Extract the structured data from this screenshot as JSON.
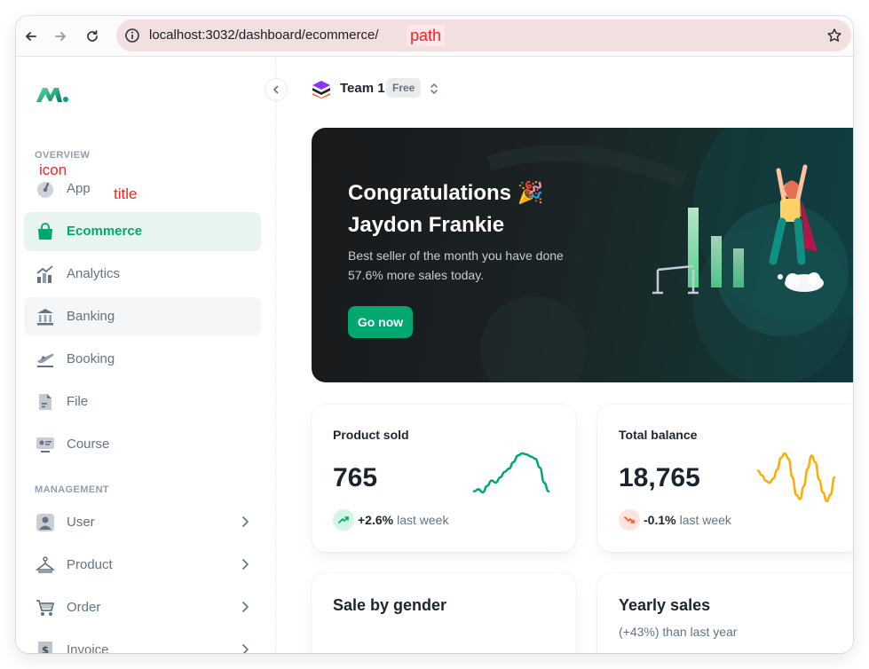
{
  "browser": {
    "url": "localhost:3032/dashboard/ecommerce/",
    "path_annotation": "path"
  },
  "annotations": {
    "icon": "icon",
    "title": "title"
  },
  "sidebar": {
    "overview_label": "OVERVIEW",
    "management_label": "MANAGEMENT",
    "overview_items": [
      {
        "label": "App",
        "icon": "speedometer-icon"
      },
      {
        "label": "Ecommerce",
        "icon": "shopping-bag-icon",
        "active": true
      },
      {
        "label": "Analytics",
        "icon": "analytics-chart-icon"
      },
      {
        "label": "Banking",
        "icon": "bank-icon"
      },
      {
        "label": "Booking",
        "icon": "airplane-icon"
      },
      {
        "label": "File",
        "icon": "file-icon"
      },
      {
        "label": "Course",
        "icon": "course-icon"
      }
    ],
    "management_items": [
      {
        "label": "User",
        "icon": "user-icon"
      },
      {
        "label": "Product",
        "icon": "hanger-icon"
      },
      {
        "label": "Order",
        "icon": "cart-icon"
      },
      {
        "label": "Invoice",
        "icon": "invoice-icon"
      }
    ]
  },
  "workspace": {
    "team": "Team 1",
    "plan": "Free"
  },
  "hero": {
    "title_line1": "Congratulations 🎉",
    "title_line2": "Jaydon Frankie",
    "description": "Best seller of the month you have done 57.6% more sales today.",
    "button": "Go now"
  },
  "stats": [
    {
      "title": "Product sold",
      "value": "765",
      "change": "+2.6%",
      "period": "last week",
      "trend": "up",
      "color": "#00a76f",
      "sparkline": [
        20,
        22,
        19,
        25,
        30,
        28,
        33,
        38,
        41,
        47,
        53,
        55,
        54,
        52,
        50,
        42,
        28,
        20
      ]
    },
    {
      "title": "Total balance",
      "value": "18,765",
      "change": "-0.1%",
      "period": "last week",
      "trend": "down",
      "color": "#ffab00",
      "sparkline": [
        44,
        40,
        35,
        33,
        37,
        45,
        56,
        60,
        55,
        38,
        22,
        18,
        30,
        46,
        58,
        52,
        36,
        24,
        16,
        22,
        38
      ]
    }
  ],
  "cards": {
    "sale_by_gender": "Sale by gender",
    "yearly_sales": "Yearly sales",
    "yearly_sub": "(+43%) than last year"
  },
  "colors": {
    "primary": "#00a76f",
    "warning": "#ffab00",
    "error": "#ff5630"
  }
}
